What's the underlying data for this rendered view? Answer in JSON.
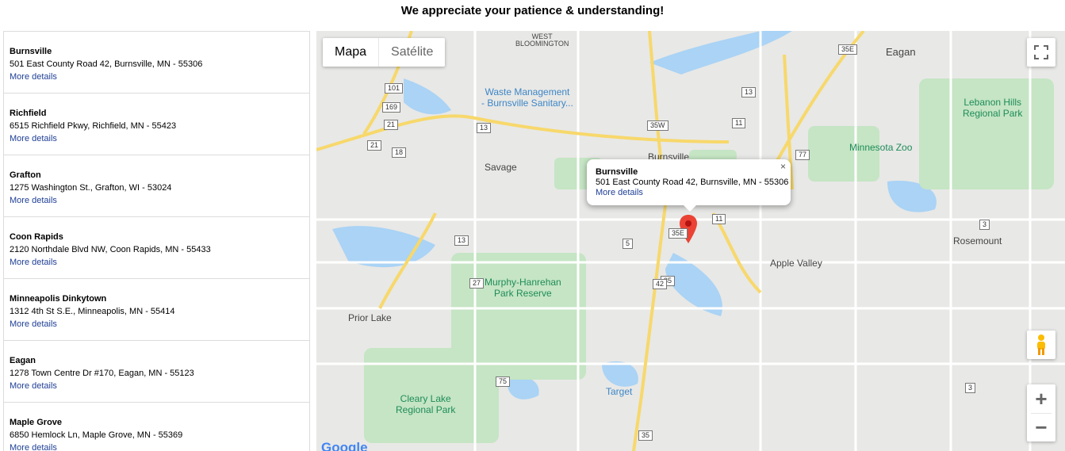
{
  "banner": {
    "text": "We appreciate your patience & understanding!"
  },
  "stores": [
    {
      "name": "Burnsville",
      "address": "501 East County Road 42, Burnsville, MN - 55306",
      "more": "More details"
    },
    {
      "name": "Richfield",
      "address": "6515 Richfield Pkwy, Richfield, MN - 55423",
      "more": "More details"
    },
    {
      "name": "Grafton",
      "address": "1275 Washington St., Grafton, WI - 53024",
      "more": "More details"
    },
    {
      "name": "Coon Rapids",
      "address": "2120 Northdale Blvd NW, Coon Rapids, MN - 55433",
      "more": "More details"
    },
    {
      "name": "Minneapolis Dinkytown",
      "address": "1312 4th St S.E., Minneapolis, MN - 55414",
      "more": "More details"
    },
    {
      "name": "Eagan",
      "address": "1278 Town Centre Dr #170, Eagan, MN - 55123",
      "more": "More details"
    },
    {
      "name": "Maple Grove",
      "address": "6850 Hemlock Ln, Maple Grove, MN - 55369",
      "more": "More details"
    }
  ],
  "map": {
    "type_buttons": {
      "map": "Mapa",
      "satellite": "Satélite"
    },
    "zoom_in": "+",
    "zoom_out": "−",
    "google_logo": "Google",
    "labels": {
      "west_bloomington": "WEST\nBLOOMINGTON",
      "eagan": "Eagan",
      "burnsville": "Burnsville",
      "savage": "Savage",
      "apple_valley": "Apple Valley",
      "rosemount": "Rosemount",
      "prior_lake": "Prior Lake",
      "lebanon_hills": "Lebanon Hills\nRegional Park",
      "minnesota_zoo": "Minnesota Zoo",
      "murphy_hanrehan": "Murphy-Hanrehan\nPark Reserve",
      "cleary_lake": "Cleary Lake\nRegional Park",
      "target": "Target",
      "waste_management": "Waste Management\n- Burnsville Sanitary..."
    },
    "route_shields": [
      "101",
      "169",
      "21",
      "21",
      "18",
      "13",
      "13",
      "13",
      "35W",
      "35E",
      "35E",
      "11",
      "11",
      "77",
      "5",
      "27",
      "35",
      "42",
      "75",
      "35",
      "3",
      "3"
    ],
    "info_window": {
      "name": "Burnsville",
      "address": "501 East County Road 42, Burnsville, MN - 55306",
      "more": "More details",
      "close": "×"
    },
    "colors": {
      "road_major": "#f7d86b",
      "water": "#aad3f5",
      "park": "#c5e5c4",
      "marker": "#ea4335"
    }
  }
}
